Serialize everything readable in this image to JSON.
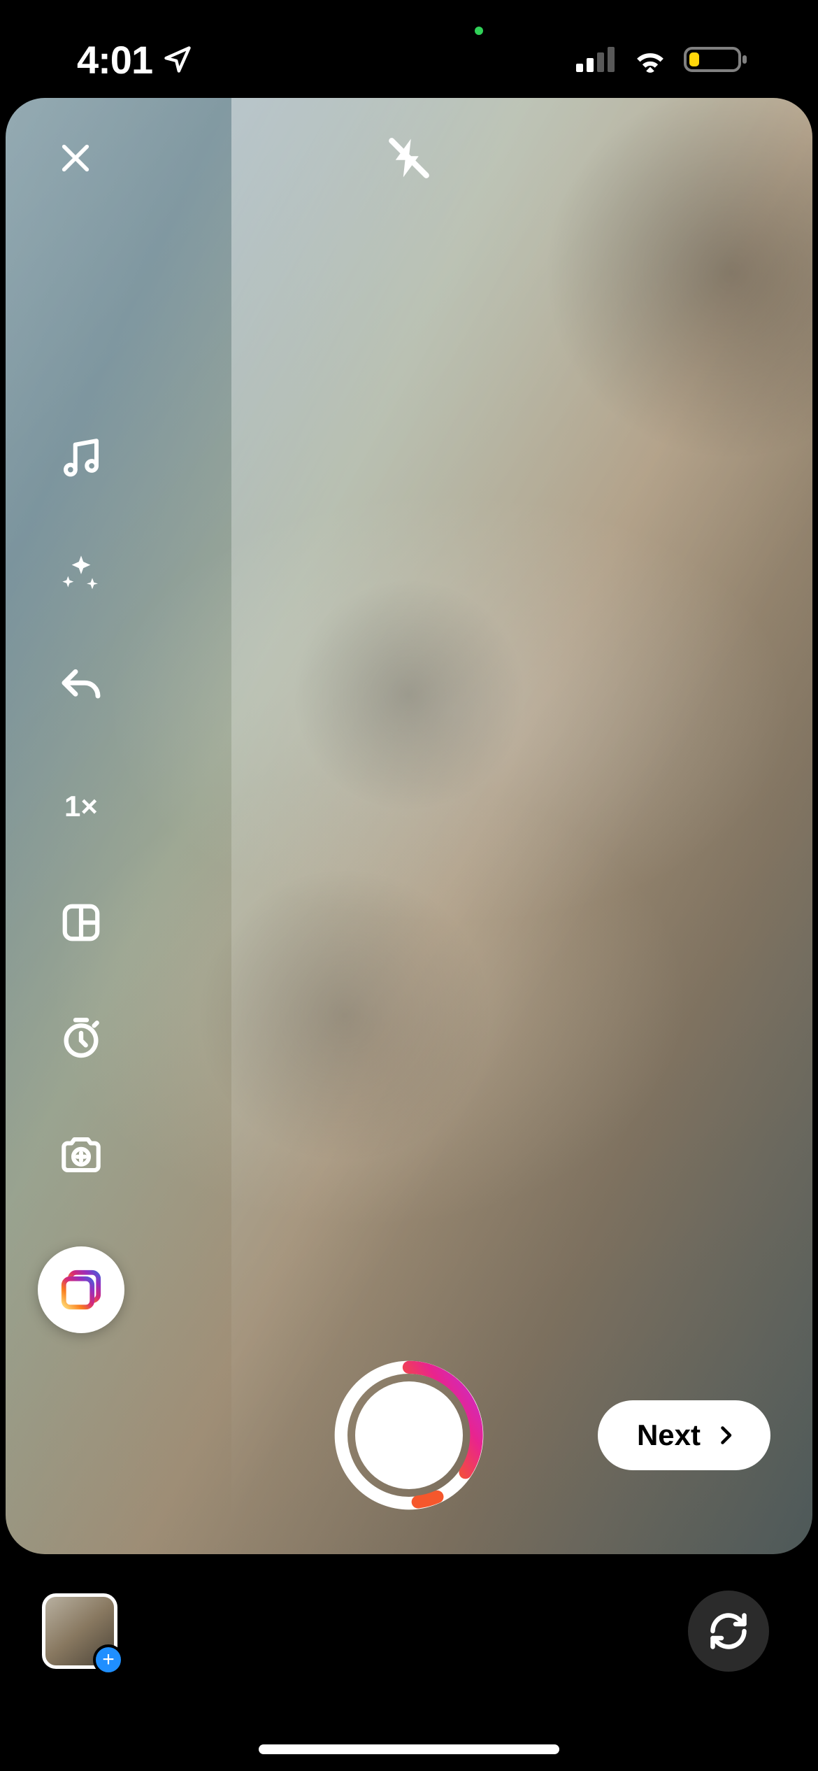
{
  "status_bar": {
    "time": "4:01",
    "location_active": true,
    "privacy_indicator": "camera-mic",
    "cellular_bars": 2,
    "wifi_active": true,
    "battery_level_pct": 18,
    "battery_low": true
  },
  "camera": {
    "flash_mode": "off",
    "zoom_label": "1×"
  },
  "tools": {
    "music": "music",
    "effects": "sparkle-effects",
    "undo": "undo",
    "zoom": "1×",
    "layout": "layout-grid",
    "timer": "timer",
    "photo_mode": "photo-shot",
    "multi_capture": "multi-capture"
  },
  "actions": {
    "close": "close",
    "next_label": "Next",
    "shutter": "shutter",
    "gallery": "open-gallery",
    "switch_camera": "switch-camera"
  }
}
